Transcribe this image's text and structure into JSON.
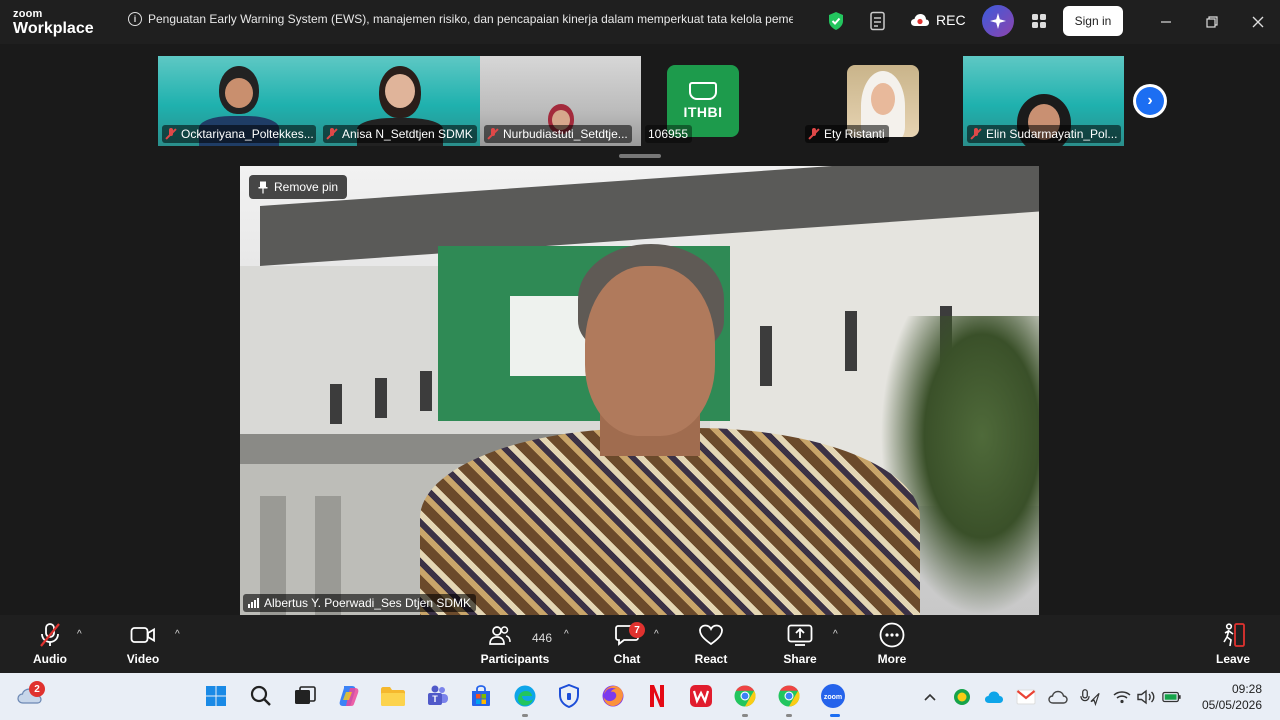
{
  "app": {
    "logo_line1": "zoom",
    "logo_line2": "Workplace",
    "meeting_topic": "Penguatan Early Warning System (EWS), manajemen risiko, dan pencapaian kinerja dalam memperkuat tata kelola pemerir",
    "rec_label": "REC",
    "sign_in_label": "Sign in"
  },
  "thumbnails": [
    {
      "name": "Ocktariyana_Poltekkes...",
      "muted": true,
      "style": "teal"
    },
    {
      "name": "Anisa N_Setdtjen SDMK",
      "muted": true,
      "style": "teal"
    },
    {
      "name": "Nurbudiastuti_Setdtje...",
      "muted": true,
      "style": "photo"
    },
    {
      "name": "106955",
      "muted": false,
      "style": "logo",
      "logo_text": "ITHBI"
    },
    {
      "name": "Ety Ristanti",
      "muted": true,
      "style": "avatar"
    },
    {
      "name": "Elin Sudarmayatin_Pol...",
      "muted": true,
      "style": "teal"
    }
  ],
  "main_video": {
    "pin_label": "Remove pin",
    "speaker_name": "Albertus Y. Poerwadi_Ses Dtjen SDMK"
  },
  "toolbar": {
    "audio_label": "Audio",
    "video_label": "Video",
    "participants_label": "Participants",
    "participants_count": "446",
    "chat_label": "Chat",
    "chat_badge": "7",
    "react_label": "React",
    "share_label": "Share",
    "more_label": "More",
    "leave_label": "Leave"
  },
  "taskbar": {
    "weather_badge": "2",
    "time": "09:28",
    "date": "05/05/2026"
  },
  "colors": {
    "accent_blue": "#1c6ef2",
    "mute_red": "#e04848",
    "leave_red": "#e0322f",
    "ithbi_green": "#1d9b4c"
  }
}
